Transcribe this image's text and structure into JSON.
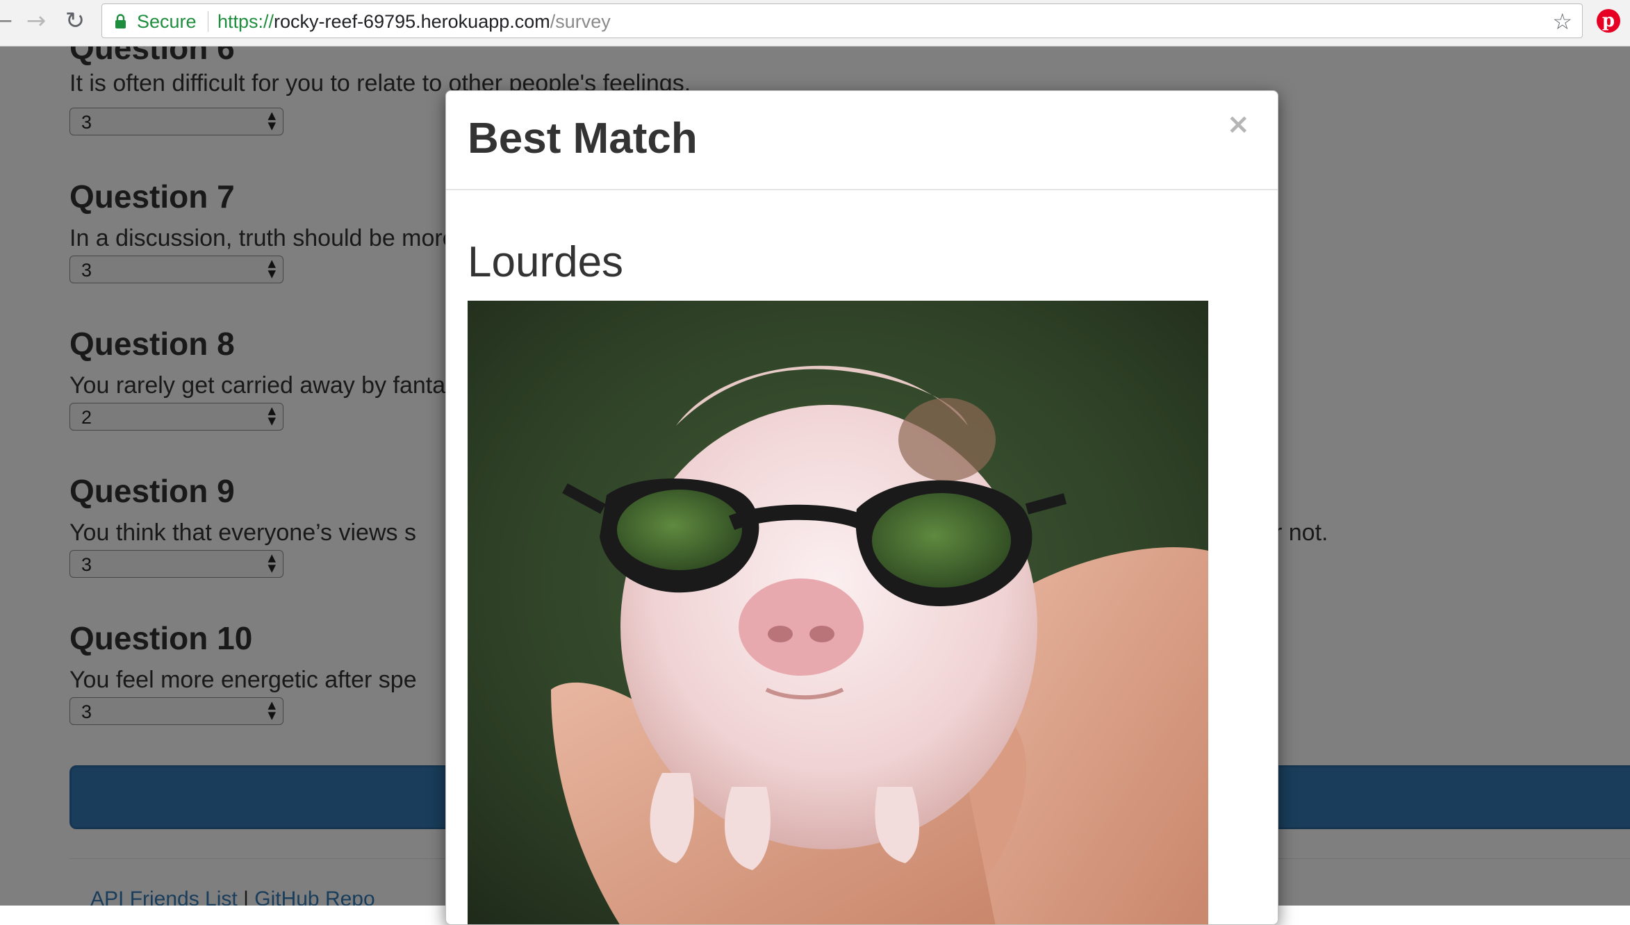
{
  "browser": {
    "secure_label": "Secure",
    "url_scheme": "https://",
    "url_host": "rocky-reef-69795.herokuapp.com",
    "url_path": "/survey"
  },
  "questions": [
    {
      "title": "Question 6",
      "text": "It is often difficult for you to relate to other people's feelings.",
      "value": "3"
    },
    {
      "title": "Question 7",
      "text": "In a discussion, truth should be more important than people's sensitivities.",
      "value": "3"
    },
    {
      "title": "Question 8",
      "text": "You rarely get carried away by fantasies and ideas.",
      "value": "2"
    },
    {
      "title": "Question 9",
      "text": "You think that everyone’s views s",
      "value": "3"
    },
    {
      "title": "Question 10",
      "text": "You feel more energetic after spe",
      "value": "3"
    }
  ],
  "question9_tail": "r not.",
  "footer": {
    "link_api": "API Friends List",
    "separator": "|",
    "link_github": "GitHub Repo"
  },
  "modal": {
    "title": "Best Match",
    "close_glyph": "×",
    "match_name": "Lourdes"
  }
}
